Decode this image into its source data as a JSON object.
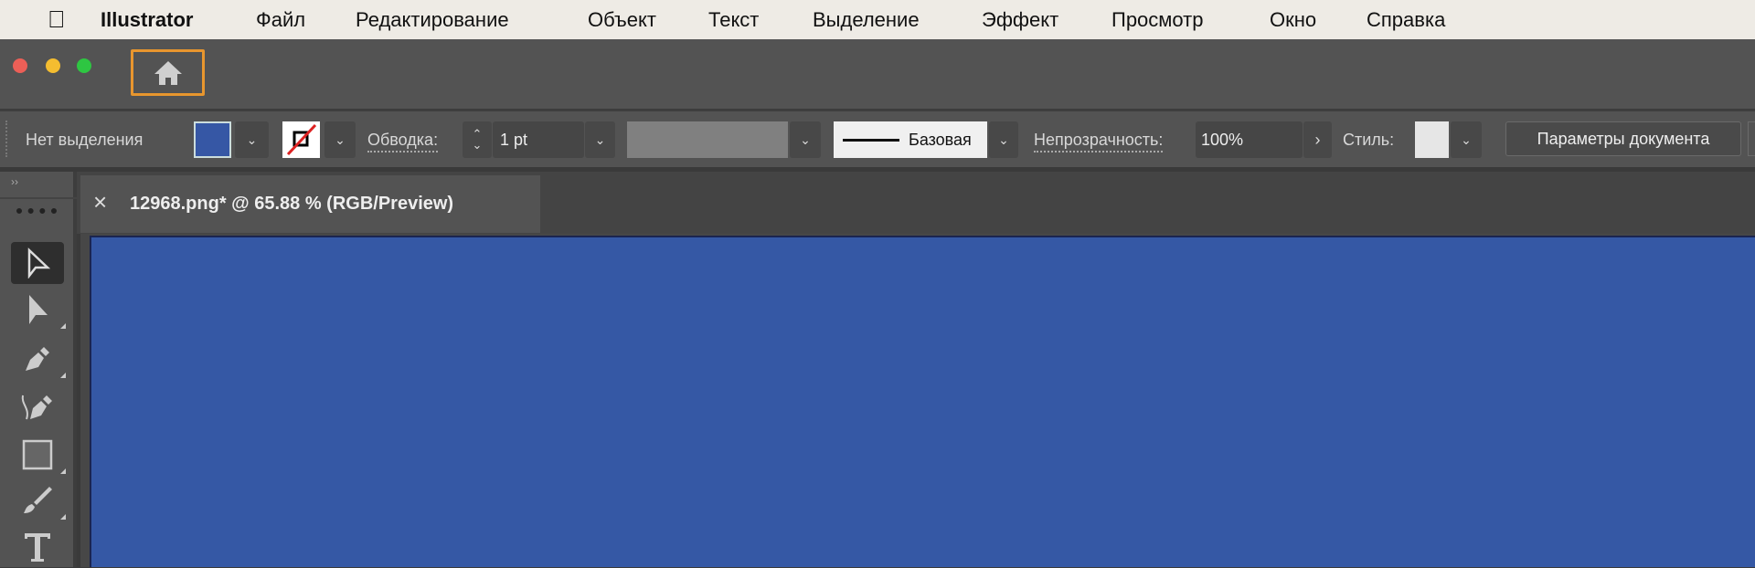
{
  "menubar": {
    "app": "Illustrator",
    "items": [
      "Файл",
      "Редактирование",
      "Объект",
      "Текст",
      "Выделение",
      "Эффект",
      "Просмотр",
      "Окно",
      "Справка"
    ]
  },
  "toolbar": {
    "selection_status": "Нет выделения",
    "fill_color": "#3657a5",
    "stroke_label": "Обводка:",
    "stroke_weight": "1 pt",
    "brush_label": "Базовая",
    "opacity_label": "Непрозрачность:",
    "opacity_value": "100%",
    "style_label": "Стиль:",
    "doc_settings": "Параметры документа"
  },
  "tab": {
    "title": "12968.png* @ 65.88 % (RGB/Preview)",
    "close": "×"
  },
  "colors": {
    "accent": "#e8962e",
    "canvas": "#3558a5"
  }
}
